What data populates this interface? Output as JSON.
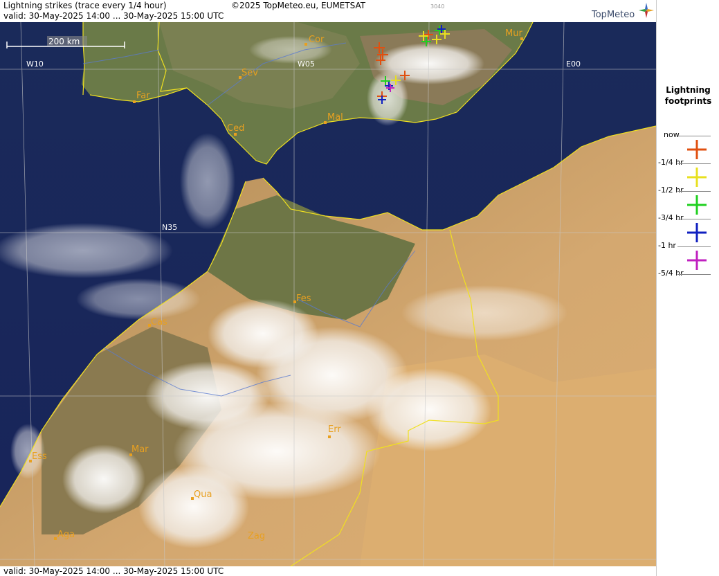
{
  "header": {
    "title": "Lightning strikes (trace every 1/4 hour)",
    "valid": "valid:  30-May-2025 14:00 ... 30-May-2025 15:00 UTC",
    "copyright": "©2025 TopMeteo.eu, EUMETSAT",
    "code": "3040",
    "logo": "TopMeteo"
  },
  "footer": {
    "valid": "valid:  30-May-2025 14:00 ... 30-May-2025 15:00 UTC"
  },
  "map": {
    "scale_label": "200 km",
    "grid_labels": [
      "W10",
      "W05",
      "E00",
      "N35"
    ],
    "cities": [
      "Cor",
      "Mur",
      "Sev",
      "Far",
      "Mal",
      "Ced",
      "Fes",
      "Cas",
      "Err",
      "Ess",
      "Mar",
      "Qua",
      "Aga",
      "Zag"
    ]
  },
  "legend": {
    "title_line1": "Lightning",
    "title_line2": "footprints",
    "labels": [
      "now",
      "-1/4 hr",
      "-1/2 hr",
      "-3/4 hr",
      "-1 hr",
      "-5/4 hr"
    ],
    "colors": [
      "#e05010",
      "#e8e020",
      "#20d020",
      "#1020c0",
      "#c020c0"
    ]
  }
}
